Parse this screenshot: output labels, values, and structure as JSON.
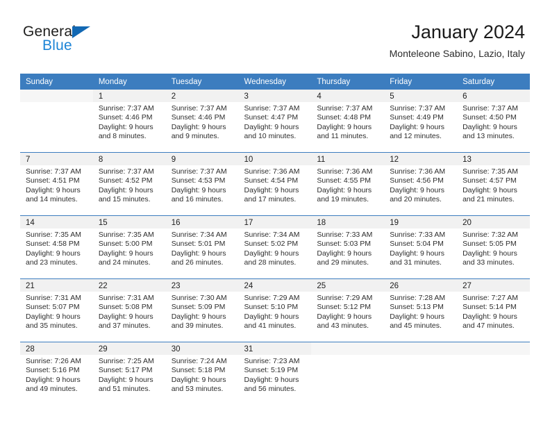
{
  "brand": {
    "name_top": "General",
    "name_bottom": "Blue",
    "triangle_icon": "blue-triangle-icon",
    "colors": {
      "blue": "#1c84d6",
      "triangle": "#1268b3",
      "dark": "#20201f"
    }
  },
  "header": {
    "title": "January 2024",
    "subtitle": "Monteleone Sabino, Lazio, Italy"
  },
  "theme": {
    "header_bg": "#3c7dbf",
    "header_text": "#ffffff",
    "daynum_bg": "#f1f1f1",
    "cell_bg": "#ffffff",
    "row_border": "#3c7dbf"
  },
  "calendar": {
    "weekdays": [
      "Sunday",
      "Monday",
      "Tuesday",
      "Wednesday",
      "Thursday",
      "Friday",
      "Saturday"
    ],
    "weeks": [
      [
        {
          "day": "",
          "sunrise": "",
          "sunset": "",
          "daylight_1": "",
          "daylight_2": ""
        },
        {
          "day": "1",
          "sunrise": "Sunrise: 7:37 AM",
          "sunset": "Sunset: 4:46 PM",
          "daylight_1": "Daylight: 9 hours",
          "daylight_2": "and 8 minutes."
        },
        {
          "day": "2",
          "sunrise": "Sunrise: 7:37 AM",
          "sunset": "Sunset: 4:46 PM",
          "daylight_1": "Daylight: 9 hours",
          "daylight_2": "and 9 minutes."
        },
        {
          "day": "3",
          "sunrise": "Sunrise: 7:37 AM",
          "sunset": "Sunset: 4:47 PM",
          "daylight_1": "Daylight: 9 hours",
          "daylight_2": "and 10 minutes."
        },
        {
          "day": "4",
          "sunrise": "Sunrise: 7:37 AM",
          "sunset": "Sunset: 4:48 PM",
          "daylight_1": "Daylight: 9 hours",
          "daylight_2": "and 11 minutes."
        },
        {
          "day": "5",
          "sunrise": "Sunrise: 7:37 AM",
          "sunset": "Sunset: 4:49 PM",
          "daylight_1": "Daylight: 9 hours",
          "daylight_2": "and 12 minutes."
        },
        {
          "day": "6",
          "sunrise": "Sunrise: 7:37 AM",
          "sunset": "Sunset: 4:50 PM",
          "daylight_1": "Daylight: 9 hours",
          "daylight_2": "and 13 minutes."
        }
      ],
      [
        {
          "day": "7",
          "sunrise": "Sunrise: 7:37 AM",
          "sunset": "Sunset: 4:51 PM",
          "daylight_1": "Daylight: 9 hours",
          "daylight_2": "and 14 minutes."
        },
        {
          "day": "8",
          "sunrise": "Sunrise: 7:37 AM",
          "sunset": "Sunset: 4:52 PM",
          "daylight_1": "Daylight: 9 hours",
          "daylight_2": "and 15 minutes."
        },
        {
          "day": "9",
          "sunrise": "Sunrise: 7:37 AM",
          "sunset": "Sunset: 4:53 PM",
          "daylight_1": "Daylight: 9 hours",
          "daylight_2": "and 16 minutes."
        },
        {
          "day": "10",
          "sunrise": "Sunrise: 7:36 AM",
          "sunset": "Sunset: 4:54 PM",
          "daylight_1": "Daylight: 9 hours",
          "daylight_2": "and 17 minutes."
        },
        {
          "day": "11",
          "sunrise": "Sunrise: 7:36 AM",
          "sunset": "Sunset: 4:55 PM",
          "daylight_1": "Daylight: 9 hours",
          "daylight_2": "and 19 minutes."
        },
        {
          "day": "12",
          "sunrise": "Sunrise: 7:36 AM",
          "sunset": "Sunset: 4:56 PM",
          "daylight_1": "Daylight: 9 hours",
          "daylight_2": "and 20 minutes."
        },
        {
          "day": "13",
          "sunrise": "Sunrise: 7:35 AM",
          "sunset": "Sunset: 4:57 PM",
          "daylight_1": "Daylight: 9 hours",
          "daylight_2": "and 21 minutes."
        }
      ],
      [
        {
          "day": "14",
          "sunrise": "Sunrise: 7:35 AM",
          "sunset": "Sunset: 4:58 PM",
          "daylight_1": "Daylight: 9 hours",
          "daylight_2": "and 23 minutes."
        },
        {
          "day": "15",
          "sunrise": "Sunrise: 7:35 AM",
          "sunset": "Sunset: 5:00 PM",
          "daylight_1": "Daylight: 9 hours",
          "daylight_2": "and 24 minutes."
        },
        {
          "day": "16",
          "sunrise": "Sunrise: 7:34 AM",
          "sunset": "Sunset: 5:01 PM",
          "daylight_1": "Daylight: 9 hours",
          "daylight_2": "and 26 minutes."
        },
        {
          "day": "17",
          "sunrise": "Sunrise: 7:34 AM",
          "sunset": "Sunset: 5:02 PM",
          "daylight_1": "Daylight: 9 hours",
          "daylight_2": "and 28 minutes."
        },
        {
          "day": "18",
          "sunrise": "Sunrise: 7:33 AM",
          "sunset": "Sunset: 5:03 PM",
          "daylight_1": "Daylight: 9 hours",
          "daylight_2": "and 29 minutes."
        },
        {
          "day": "19",
          "sunrise": "Sunrise: 7:33 AM",
          "sunset": "Sunset: 5:04 PM",
          "daylight_1": "Daylight: 9 hours",
          "daylight_2": "and 31 minutes."
        },
        {
          "day": "20",
          "sunrise": "Sunrise: 7:32 AM",
          "sunset": "Sunset: 5:05 PM",
          "daylight_1": "Daylight: 9 hours",
          "daylight_2": "and 33 minutes."
        }
      ],
      [
        {
          "day": "21",
          "sunrise": "Sunrise: 7:31 AM",
          "sunset": "Sunset: 5:07 PM",
          "daylight_1": "Daylight: 9 hours",
          "daylight_2": "and 35 minutes."
        },
        {
          "day": "22",
          "sunrise": "Sunrise: 7:31 AM",
          "sunset": "Sunset: 5:08 PM",
          "daylight_1": "Daylight: 9 hours",
          "daylight_2": "and 37 minutes."
        },
        {
          "day": "23",
          "sunrise": "Sunrise: 7:30 AM",
          "sunset": "Sunset: 5:09 PM",
          "daylight_1": "Daylight: 9 hours",
          "daylight_2": "and 39 minutes."
        },
        {
          "day": "24",
          "sunrise": "Sunrise: 7:29 AM",
          "sunset": "Sunset: 5:10 PM",
          "daylight_1": "Daylight: 9 hours",
          "daylight_2": "and 41 minutes."
        },
        {
          "day": "25",
          "sunrise": "Sunrise: 7:29 AM",
          "sunset": "Sunset: 5:12 PM",
          "daylight_1": "Daylight: 9 hours",
          "daylight_2": "and 43 minutes."
        },
        {
          "day": "26",
          "sunrise": "Sunrise: 7:28 AM",
          "sunset": "Sunset: 5:13 PM",
          "daylight_1": "Daylight: 9 hours",
          "daylight_2": "and 45 minutes."
        },
        {
          "day": "27",
          "sunrise": "Sunrise: 7:27 AM",
          "sunset": "Sunset: 5:14 PM",
          "daylight_1": "Daylight: 9 hours",
          "daylight_2": "and 47 minutes."
        }
      ],
      [
        {
          "day": "28",
          "sunrise": "Sunrise: 7:26 AM",
          "sunset": "Sunset: 5:16 PM",
          "daylight_1": "Daylight: 9 hours",
          "daylight_2": "and 49 minutes."
        },
        {
          "day": "29",
          "sunrise": "Sunrise: 7:25 AM",
          "sunset": "Sunset: 5:17 PM",
          "daylight_1": "Daylight: 9 hours",
          "daylight_2": "and 51 minutes."
        },
        {
          "day": "30",
          "sunrise": "Sunrise: 7:24 AM",
          "sunset": "Sunset: 5:18 PM",
          "daylight_1": "Daylight: 9 hours",
          "daylight_2": "and 53 minutes."
        },
        {
          "day": "31",
          "sunrise": "Sunrise: 7:23 AM",
          "sunset": "Sunset: 5:19 PM",
          "daylight_1": "Daylight: 9 hours",
          "daylight_2": "and 56 minutes."
        },
        {
          "day": "",
          "sunrise": "",
          "sunset": "",
          "daylight_1": "",
          "daylight_2": ""
        },
        {
          "day": "",
          "sunrise": "",
          "sunset": "",
          "daylight_1": "",
          "daylight_2": ""
        },
        {
          "day": "",
          "sunrise": "",
          "sunset": "",
          "daylight_1": "",
          "daylight_2": ""
        }
      ]
    ]
  }
}
